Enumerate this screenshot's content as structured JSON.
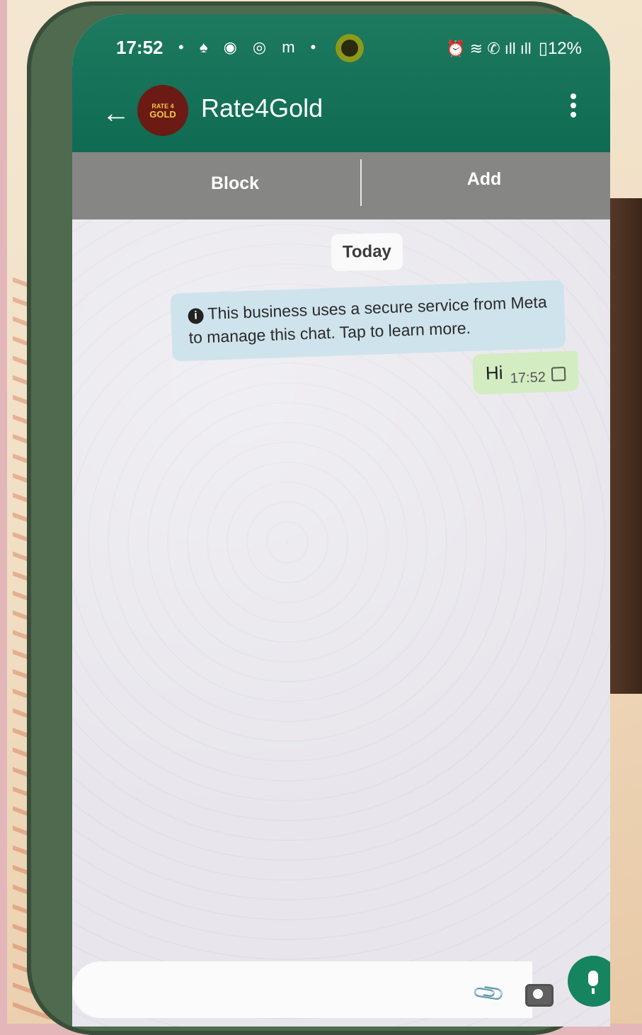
{
  "status_bar": {
    "time": "17:52",
    "notifications": "• ♠ ◉ ◎ m •",
    "system": "⏰ ≋ ✆ ıll ıll",
    "battery": "▯12%"
  },
  "header": {
    "back_icon": "←",
    "avatar": {
      "line1": "RATE 4",
      "line2": "GOLD"
    },
    "title": "Rate4Gold"
  },
  "actions": {
    "block_label": "Block",
    "add_label": "Add"
  },
  "chat": {
    "day_label": "Today",
    "system_icon": "i",
    "system_message": "This business uses a secure service from Meta to manage this chat. Tap to learn more.",
    "messages": [
      {
        "text": "Hi",
        "time": "17:52",
        "status": "pending"
      }
    ]
  },
  "input": {
    "attach_icon": "📎"
  },
  "colors": {
    "header": "#1d7a5f",
    "action_bar": "#868684",
    "outgoing_bubble": "#d4ecc2",
    "system_note": "#cfe3ec",
    "mic_button": "#15845f"
  }
}
